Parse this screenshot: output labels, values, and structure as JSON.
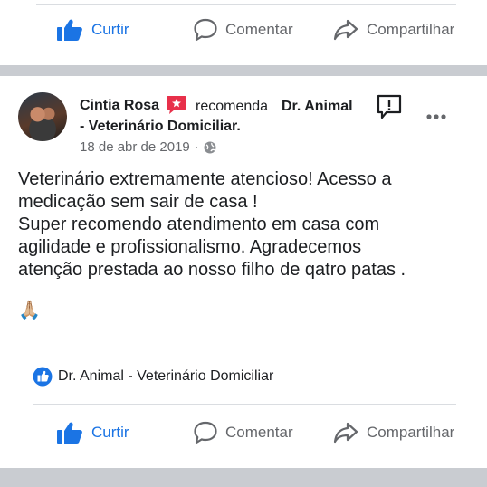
{
  "top_actions": {
    "like": "Curtir",
    "comment": "Comentar",
    "share": "Compartilhar"
  },
  "post": {
    "author": "Cintia Rosa",
    "recommends_text": "recomenda",
    "page_line1": "Dr. Animal",
    "page_line2": "- Veterinário Domiciliar.",
    "date": "18 de abr de 2019",
    "date_separator": "·",
    "body": "Veterinário  extremamente atencioso! Acesso a\nmedicação sem sair de casa !\nSuper recomendo atendimento em casa com\nagilidade e profissionalismo. Agradecemos\natenção prestada ao nosso filho de qatro patas .",
    "emoji": "🙏🏼",
    "recommended_page": "Dr. Animal - Veterinário Domiciliar"
  },
  "bottom_actions": {
    "like": "Curtir",
    "comment": "Comentar",
    "share": "Compartilhar"
  },
  "colors": {
    "facebook_blue": "#1b74e4",
    "recommend_red": "#e8304a",
    "muted_text": "#65676b",
    "separator": "#c9ccd1"
  },
  "icons": [
    "thumbs-up-icon",
    "comment-bubble-icon",
    "share-arrow-icon",
    "recommend-badge-icon",
    "report-icon",
    "more-options-icon",
    "globe-icon",
    "like-reaction-icon"
  ]
}
